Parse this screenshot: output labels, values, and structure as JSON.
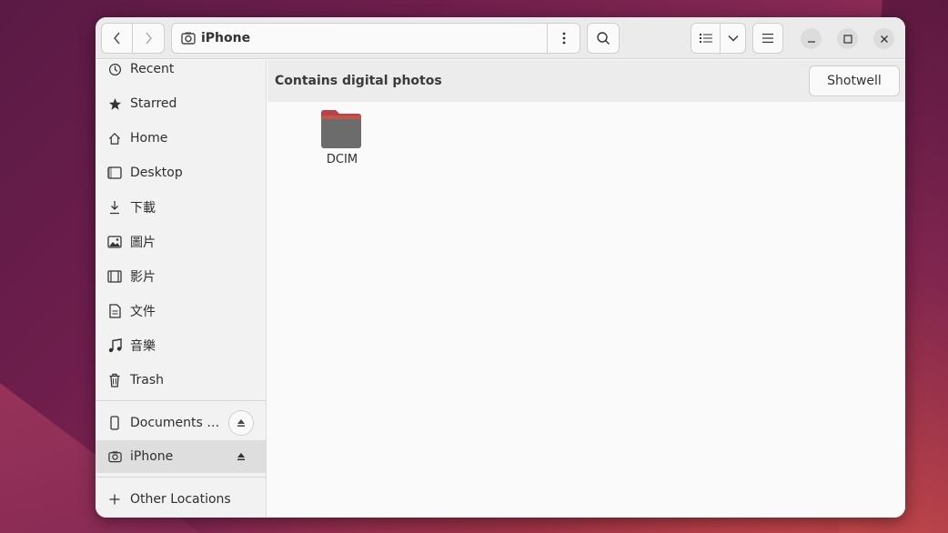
{
  "headerbar": {
    "location_title": "iPhone"
  },
  "sidebar": {
    "places": [
      {
        "label": "Recent",
        "icon": "clock-icon"
      },
      {
        "label": "Starred",
        "icon": "star-icon"
      },
      {
        "label": "Home",
        "icon": "home-icon"
      },
      {
        "label": "Desktop",
        "icon": "desktop-icon"
      },
      {
        "label": "下載",
        "icon": "download-icon"
      },
      {
        "label": "圖片",
        "icon": "pictures-icon"
      },
      {
        "label": "影片",
        "icon": "videos-icon"
      },
      {
        "label": "文件",
        "icon": "document-icon"
      },
      {
        "label": "音樂",
        "icon": "music-icon"
      },
      {
        "label": "Trash",
        "icon": "trash-icon"
      }
    ],
    "devices": [
      {
        "label": "Documents …",
        "icon": "phone-icon"
      },
      {
        "label": "iPhone",
        "icon": "camera-icon"
      }
    ],
    "other_locations": "Other Locations"
  },
  "infobar": {
    "message": "Contains digital photos",
    "action_label": "Shotwell"
  },
  "files": [
    {
      "name": "DCIM",
      "type": "folder"
    }
  ],
  "colors": {
    "folder_tab": "#b5424f",
    "folder_body": "#6c6c6c",
    "active_row": "#dedede"
  }
}
